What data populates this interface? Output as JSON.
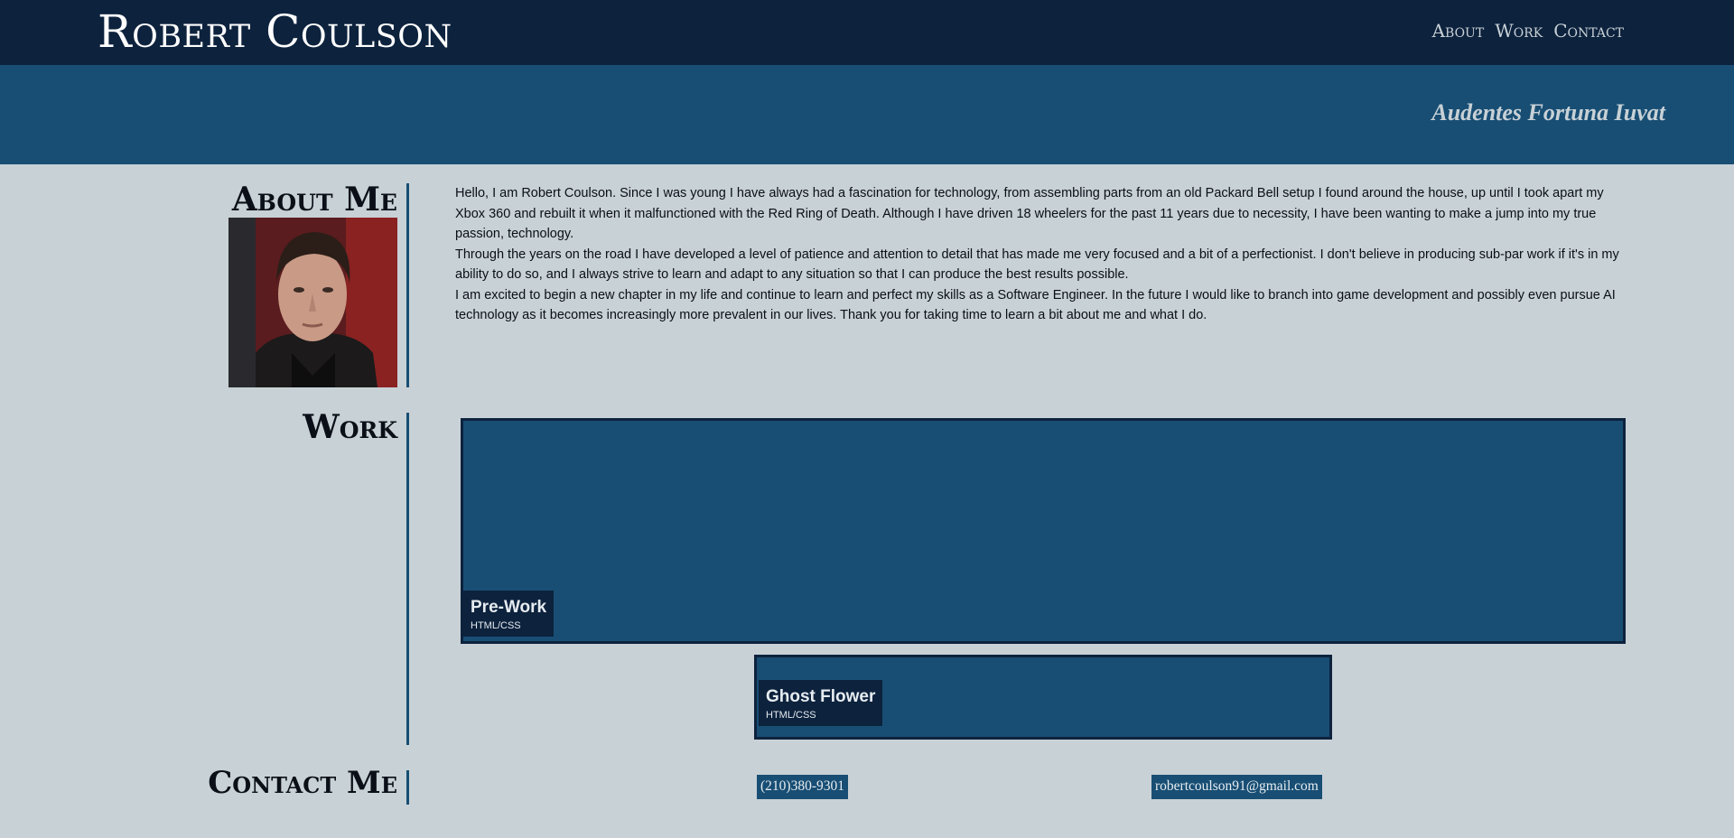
{
  "header": {
    "title": "Robert Coulson",
    "nav": [
      "About",
      "Work",
      "Contact"
    ]
  },
  "hero": {
    "motto": "Audentes Fortuna Iuvat"
  },
  "about": {
    "heading": "About Me",
    "paragraphs": [
      "Hello, I am Robert Coulson. Since I was young I have always had a fascination for technology, from assembling parts from an old Packard Bell setup I found around the house, up until I took apart my Xbox 360 and rebuilt it when it malfunctioned with the Red Ring of Death. Although I have driven 18 wheelers for the past 11 years due to necessity, I have been wanting to make a jump into my true passion, technology.",
      "Through the years on the road I have developed a level of patience and attention to detail that has made me very focused and a bit of a perfectionist. I don't believe in producing sub-par work if it's in my ability to do so, and I always strive to learn and adapt to any situation so that I can produce the best results possible.",
      "I am excited to begin a new chapter in my life and continue to learn and perfect my skills as a Software Engineer. In the future I would like to branch into game development and possibly even pursue AI technology as it becomes increasingly more prevalent in our lives. Thank you for taking time to learn a bit about me and what I do."
    ]
  },
  "work": {
    "heading": "Work",
    "projects": [
      {
        "title": "Pre-Work",
        "tag": "HTML/CSS"
      },
      {
        "title": "Ghost Flower",
        "tag": "HTML/CSS"
      }
    ]
  },
  "contact": {
    "heading": "Contact Me",
    "phone": "(210)380-9301",
    "email": "robertcoulson91@gmail.com"
  },
  "colors": {
    "navy": "#0d223d",
    "blue": "#184e74",
    "background": "#c8d1d6"
  }
}
